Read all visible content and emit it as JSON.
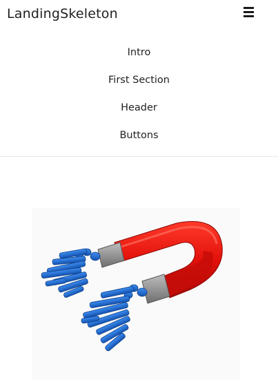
{
  "header": {
    "brand": "LandingSkeleton",
    "menu_icon": "hamburger-menu-icon"
  },
  "nav": {
    "items": [
      {
        "label": "Intro"
      },
      {
        "label": "First Section"
      },
      {
        "label": "Header"
      },
      {
        "label": "Buttons"
      }
    ]
  },
  "hero": {
    "image": "magnet-attracting-people-illustration"
  },
  "colors": {
    "magnet_red": "#e3120b",
    "magnet_tip": "#8c8c8c",
    "figures_blue": "#1f6fd1",
    "divider": "#e6e6e6"
  }
}
